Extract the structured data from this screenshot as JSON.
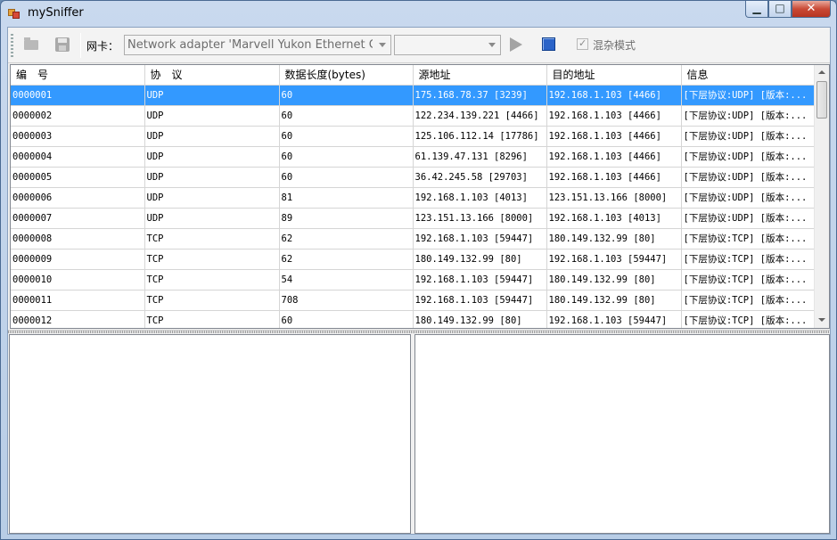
{
  "window": {
    "title": "mySniffer",
    "minimize_glyph": "▁",
    "maximize_glyph": "□",
    "close_glyph": "✕"
  },
  "toolbar": {
    "open_icon": "folder-icon",
    "save_icon": "save-icon",
    "nic_label": "网卡：",
    "nic_selected": "Network adapter 'Marvell Yukon Ethernet Controller'",
    "filter_selected": "",
    "start_icon": "play-icon",
    "stop_icon": "stop-icon",
    "promiscuous_checked_glyph": "✓",
    "promiscuous_label": "混杂模式"
  },
  "packets": {
    "columns": [
      "编　号",
      "协　议",
      "数据长度(bytes)",
      "源地址",
      "目的地址",
      "信息"
    ],
    "selected_row": 0,
    "rows": [
      [
        "0000001",
        "UDP",
        "60",
        "175.168.78.37 [3239]",
        "192.168.1.103 [4466]",
        "[下层协议:UDP] [版本:..."
      ],
      [
        "0000002",
        "UDP",
        "60",
        "122.234.139.221 [4466]",
        "192.168.1.103 [4466]",
        "[下层协议:UDP] [版本:..."
      ],
      [
        "0000003",
        "UDP",
        "60",
        "125.106.112.14 [17786]",
        "192.168.1.103 [4466]",
        "[下层协议:UDP] [版本:..."
      ],
      [
        "0000004",
        "UDP",
        "60",
        "61.139.47.131 [8296]",
        "192.168.1.103 [4466]",
        "[下层协议:UDP] [版本:..."
      ],
      [
        "0000005",
        "UDP",
        "60",
        "36.42.245.58 [29703]",
        "192.168.1.103 [4466]",
        "[下层协议:UDP] [版本:..."
      ],
      [
        "0000006",
        "UDP",
        "81",
        "192.168.1.103 [4013]",
        "123.151.13.166 [8000]",
        "[下层协议:UDP] [版本:..."
      ],
      [
        "0000007",
        "UDP",
        "89",
        "123.151.13.166 [8000]",
        "192.168.1.103 [4013]",
        "[下层协议:UDP] [版本:..."
      ],
      [
        "0000008",
        "TCP",
        "62",
        "192.168.1.103 [59447]",
        "180.149.132.99 [80]",
        "[下层协议:TCP] [版本:..."
      ],
      [
        "0000009",
        "TCP",
        "62",
        "180.149.132.99 [80]",
        "192.168.1.103 [59447]",
        "[下层协议:TCP] [版本:..."
      ],
      [
        "0000010",
        "TCP",
        "54",
        "192.168.1.103 [59447]",
        "180.149.132.99 [80]",
        "[下层协议:TCP] [版本:..."
      ],
      [
        "0000011",
        "TCP",
        "708",
        "192.168.1.103 [59447]",
        "180.149.132.99 [80]",
        "[下层协议:TCP] [版本:..."
      ],
      [
        "0000012",
        "TCP",
        "60",
        "180.149.132.99 [80]",
        "192.168.1.103 [59447]",
        "[下层协议:TCP] [版本:..."
      ]
    ]
  },
  "colors": {
    "selection": "#3399ff",
    "stop_button": "#2a63c8",
    "close_button": "#c94a36"
  }
}
